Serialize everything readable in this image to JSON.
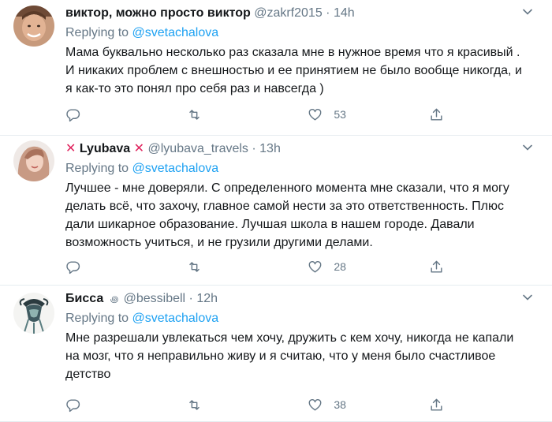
{
  "tweets": [
    {
      "name": "виктор, можно просто виктор",
      "handle": "@zakrf2015",
      "separator": "·",
      "time": "14h",
      "replying_label": "Replying to",
      "replying_to": "@svetachalova",
      "text": "Мама буквально несколько раз сказала мне в нужное время что я красивый . И никаких проблем с внешностью и ее принятием не было вообще никогда, и я как-то это понял про себя раз и навсегда )",
      "likes": "53"
    },
    {
      "name_prefix": "✕",
      "name": "Lyubava",
      "name_suffix": "✕",
      "handle": "@lyubava_travels",
      "separator": "·",
      "time": "13h",
      "replying_label": "Replying to",
      "replying_to": "@svetachalova",
      "text": "Лучшее - мне доверяли. С определенного момента мне сказали, что я могу делать всё, что захочу, главное самой нести за это ответственность. Плюс дали шикарное образование. Лучшая школа в нашем городе. Давали возможность учиться, и не грузили другими делами.",
      "likes": "28"
    },
    {
      "name": "Бисса",
      "verified_mark": "꩜",
      "handle": "@bessibell",
      "separator": "·",
      "time": "12h",
      "replying_label": "Replying to",
      "replying_to": "@svetachalova",
      "text": "Мне разрешали увлекаться чем хочу, дружить с кем хочу, никогда не капали на мозг, что я неправильно живу и я считаю, что у меня было счастливое детство",
      "likes": "38"
    }
  ],
  "colors": {
    "name": "#14171a",
    "secondary": "#657786",
    "link": "#1da1f2",
    "divider": "#e6ecf0",
    "x_mark": "#e0245e"
  },
  "icons": [
    "reply-icon",
    "retweet-icon",
    "like-icon",
    "share-icon",
    "chevron-down-icon"
  ]
}
